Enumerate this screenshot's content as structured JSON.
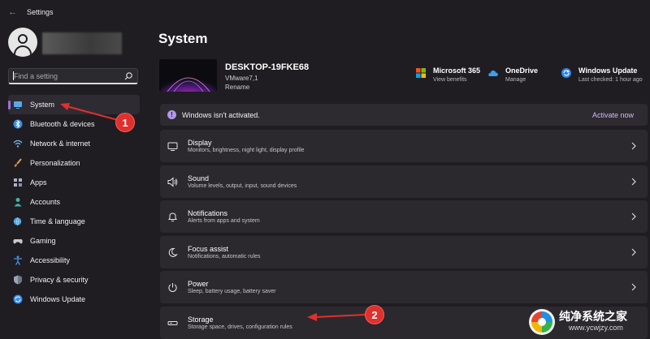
{
  "window": {
    "title": "Settings"
  },
  "sidebar": {
    "search_placeholder": "Find a setting",
    "items": [
      {
        "label": "System",
        "icon": "display-icon",
        "color": "#5aa9e6",
        "active": true
      },
      {
        "label": "Bluetooth & devices",
        "icon": "bluetooth-icon",
        "color": "#3b8fe0"
      },
      {
        "label": "Network & internet",
        "icon": "wifi-icon",
        "color": "#6fb3f0"
      },
      {
        "label": "Personalization",
        "icon": "brush-icon",
        "color": "#e8a050"
      },
      {
        "label": "Apps",
        "icon": "apps-icon",
        "color": "#a9b4c6"
      },
      {
        "label": "Accounts",
        "icon": "person-icon",
        "color": "#3fb6a8"
      },
      {
        "label": "Time & language",
        "icon": "globe-clock-icon",
        "color": "#4aa0e0"
      },
      {
        "label": "Gaming",
        "icon": "gamepad-icon",
        "color": "#c9c9c9"
      },
      {
        "label": "Accessibility",
        "icon": "accessibility-icon",
        "color": "#4a90e8"
      },
      {
        "label": "Privacy & security",
        "icon": "shield-icon",
        "color": "#9aa4b2"
      },
      {
        "label": "Windows Update",
        "icon": "update-icon",
        "color": "#3a8ee6"
      }
    ]
  },
  "main": {
    "title": "System",
    "device": {
      "name": "DESKTOP-19FKE68",
      "model": "VMware7,1",
      "rename": "Rename"
    },
    "quick_links": [
      {
        "title": "Microsoft 365",
        "subtitle": "View benefits",
        "icon": "microsoft-logo-icon"
      },
      {
        "title": "OneDrive",
        "subtitle": "Manage",
        "icon": "onedrive-cloud-icon"
      },
      {
        "title": "Windows Update",
        "subtitle": "Last checked: 1 hour ago",
        "icon": "windows-update-icon"
      }
    ],
    "activation": {
      "message": "Windows isn't activated.",
      "link": "Activate now"
    },
    "settings": [
      {
        "title": "Display",
        "subtitle": "Monitors, brightness, night light, display profile",
        "icon": "monitor-icon"
      },
      {
        "title": "Sound",
        "subtitle": "Volume levels, output, input, sound devices",
        "icon": "speaker-icon"
      },
      {
        "title": "Notifications",
        "subtitle": "Alerts from apps and system",
        "icon": "bell-icon"
      },
      {
        "title": "Focus assist",
        "subtitle": "Notifications, automatic rules",
        "icon": "moon-icon"
      },
      {
        "title": "Power",
        "subtitle": "Sleep, battery usage, battery saver",
        "icon": "power-icon"
      },
      {
        "title": "Storage",
        "subtitle": "Storage space, drives, configuration rules",
        "icon": "storage-drive-icon"
      }
    ]
  },
  "annotations": {
    "callout_1": "1",
    "callout_2": "2",
    "color": "#e0302e"
  },
  "watermark": {
    "text": "纯净系统之家",
    "url": "www.ycwjzy.com"
  },
  "colors": {
    "accent": "#9e6ce0",
    "link": "#d3b6ff",
    "background": "#1f1d22",
    "card": "#2b292e"
  }
}
